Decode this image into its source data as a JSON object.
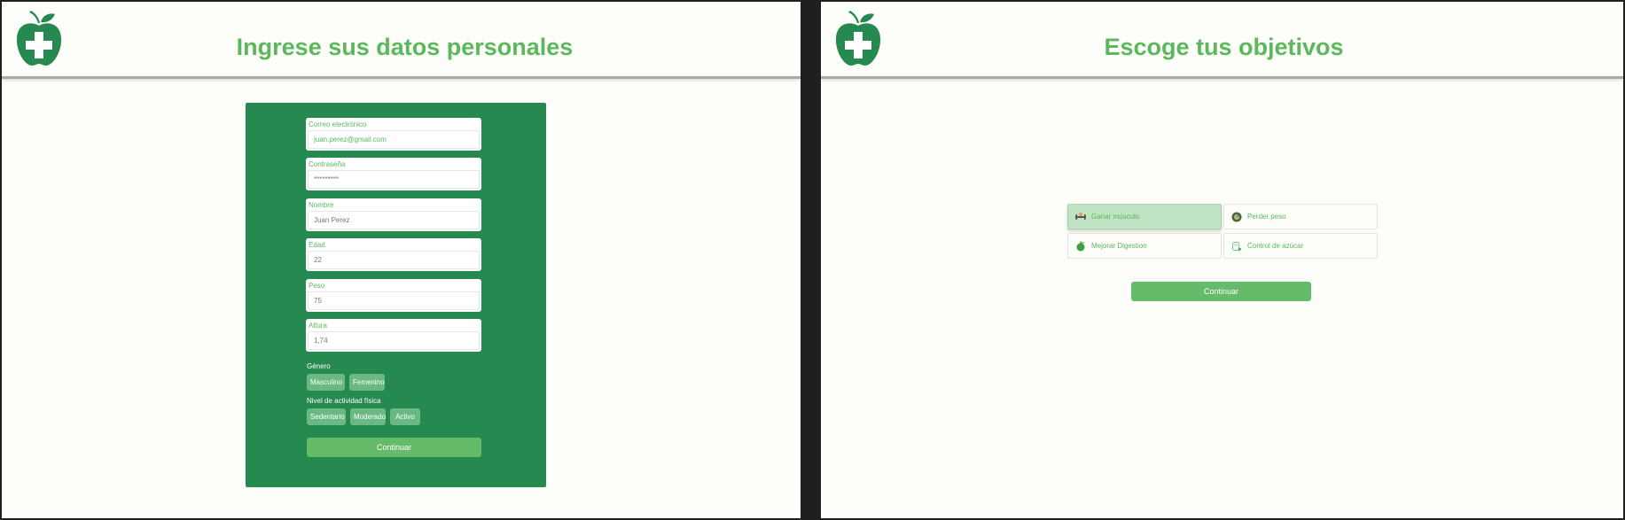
{
  "left": {
    "title": "Ingrese sus datos personales",
    "fields": [
      {
        "label": "Correo electrónico",
        "value": "juan.perez@gmail.com"
      },
      {
        "label": "Contraseña",
        "value": "*********"
      },
      {
        "label": "Nombre",
        "value": "Juan Perez"
      },
      {
        "label": "Edad",
        "value": "22"
      },
      {
        "label": "Peso",
        "value": "75"
      },
      {
        "label": "Altura",
        "value": "1,74"
      }
    ],
    "gender": {
      "label": "Género",
      "options": [
        "Masculino",
        "Femenino"
      ]
    },
    "activity": {
      "label": "Nivel de actividad física",
      "options": [
        "Sedentario",
        "Moderado",
        "Activo"
      ]
    },
    "continue_label": "Continuar"
  },
  "right": {
    "title": "Escoge tus objetivos",
    "goals": [
      {
        "label": "Ganar músculo",
        "icon": "muscle-icon",
        "selected": true
      },
      {
        "label": "Perder peso",
        "icon": "scale-icon",
        "selected": false
      },
      {
        "label": "Mejorar Digestion",
        "icon": "apple-icon",
        "selected": false
      },
      {
        "label": "Control de azúcar",
        "icon": "glucose-meter-icon",
        "selected": false
      }
    ],
    "continue_label": "Continuar"
  },
  "colors": {
    "brand_green": "#268a50",
    "accent_green": "#5cb85c",
    "button_green": "#66bb6a",
    "selected_bg": "#bfe3c3",
    "page_bg": "#fdfdf9"
  }
}
